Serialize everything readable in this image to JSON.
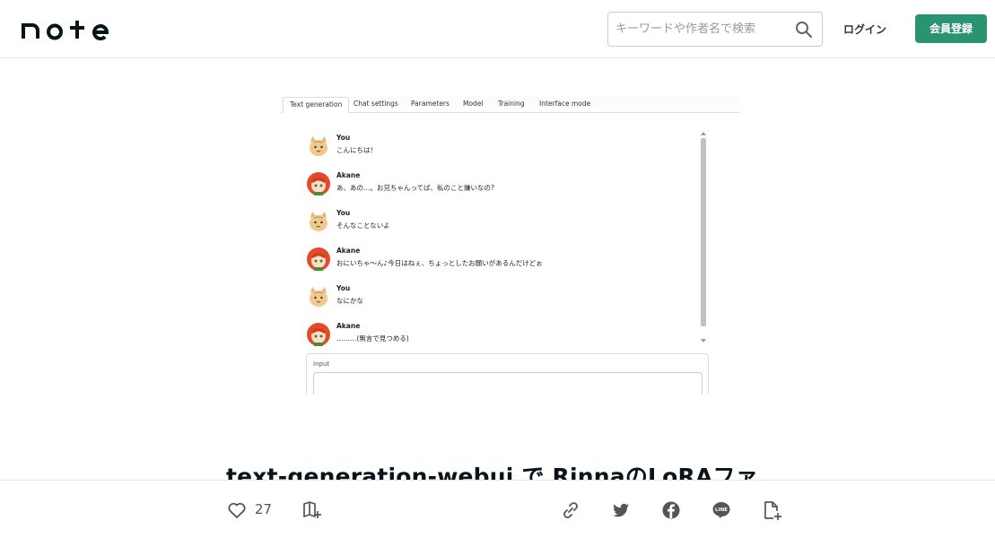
{
  "header": {
    "logo_text": "note",
    "search": {
      "placeholder": "キーワードや作者名で検索",
      "value": ""
    },
    "login_label": "ログイン",
    "signup_label": "会員登録",
    "accent_color": "#2a9371"
  },
  "screenshot": {
    "tabs": [
      {
        "label": "Text generation",
        "active": true
      },
      {
        "label": "Chat settings"
      },
      {
        "label": "Parameters"
      },
      {
        "label": "Model"
      },
      {
        "label": "Training"
      },
      {
        "label": "Interface mode"
      }
    ],
    "messages": [
      {
        "name": "You",
        "text": "こんにちは！",
        "avatar": "cat-avatar"
      },
      {
        "name": "Akane",
        "text": "あ、あの…。お兄ちゃんってば、私のこと嫌いなの?",
        "avatar": "girl-avatar"
      },
      {
        "name": "You",
        "text": "そんなことないよ",
        "avatar": "cat-avatar"
      },
      {
        "name": "Akane",
        "text": "おにいちゃ～ん♪今日はねぇ、ちょっとしたお願いがあるんだけどぉ",
        "avatar": "girl-avatar"
      },
      {
        "name": "You",
        "text": "なにかな",
        "avatar": "cat-avatar"
      },
      {
        "name": "Akane",
        "text": "………(無言で見つめる)",
        "avatar": "girl-avatar"
      }
    ],
    "input_label": "Input"
  },
  "article": {
    "title": "text-generation-webui で RinnaのLoRAファ"
  },
  "actionbar": {
    "like_count": "27",
    "icons": [
      "heart-icon",
      "magazine-add-icon",
      "link-icon",
      "twitter-icon",
      "facebook-icon",
      "line-icon",
      "note-add-icon"
    ]
  }
}
